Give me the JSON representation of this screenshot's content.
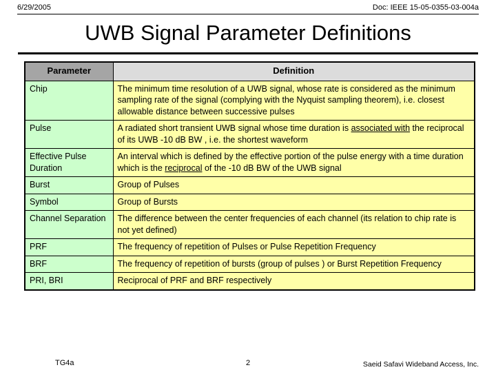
{
  "header": {
    "date": "6/29/2005",
    "doc_id": "Doc: IEEE 15-05-0355-03-004a"
  },
  "title": "UWB Signal Parameter Definitions",
  "table": {
    "columns": [
      {
        "key": "parameter",
        "label": "Parameter"
      },
      {
        "key": "definition",
        "label": "Definition"
      }
    ],
    "header_colors": {
      "parameter_bg": "#a5a5a5",
      "definition_bg": "#dcdcdc"
    },
    "cell_colors": {
      "parameter_bg": "#ccffcc",
      "definition_bg": "#ffffa8"
    },
    "rows": [
      {
        "parameter": "Chip",
        "definition": "The minimum time resolution of a UWB signal, whose rate is considered as the minimum sampling rate of the signal (complying with the Nyquist sampling theorem), i.e. closest allowable distance between successive pulses"
      },
      {
        "parameter": "Pulse",
        "definition_pre": "A radiated short transient UWB signal whose time duration is ",
        "definition_underlined": "associated with",
        "definition_post": " the reciprocal of its UWB -10 dB BW , i.e. the shortest waveform"
      },
      {
        "parameter": "Effective Pulse Duration",
        "definition_pre": "An interval which is defined by the effective portion of the pulse energy with a time duration which is the ",
        "definition_underlined": "reciprocal",
        "definition_post": " of the -10 dB BW of the UWB signal"
      },
      {
        "parameter": "Burst",
        "definition": "Group of Pulses"
      },
      {
        "parameter": "Symbol",
        "definition": "Group of Bursts"
      },
      {
        "parameter": "Channel Separation",
        "definition": "The difference between the center frequencies of each channel (its relation to chip rate is not yet defined)"
      },
      {
        "parameter": "PRF",
        "definition": "The frequency of repetition of Pulses or Pulse Repetition Frequency"
      },
      {
        "parameter": "BRF",
        "definition": "The frequency of repetition of bursts (group of pulses ) or Burst Repetition Frequency"
      },
      {
        "parameter": "PRI, BRI",
        "definition": "Reciprocal of PRF and BRF respectively"
      }
    ]
  },
  "footer": {
    "left": "TG4a",
    "page_number": "2",
    "right": "Saeid Safavi Wideband Access, Inc."
  }
}
